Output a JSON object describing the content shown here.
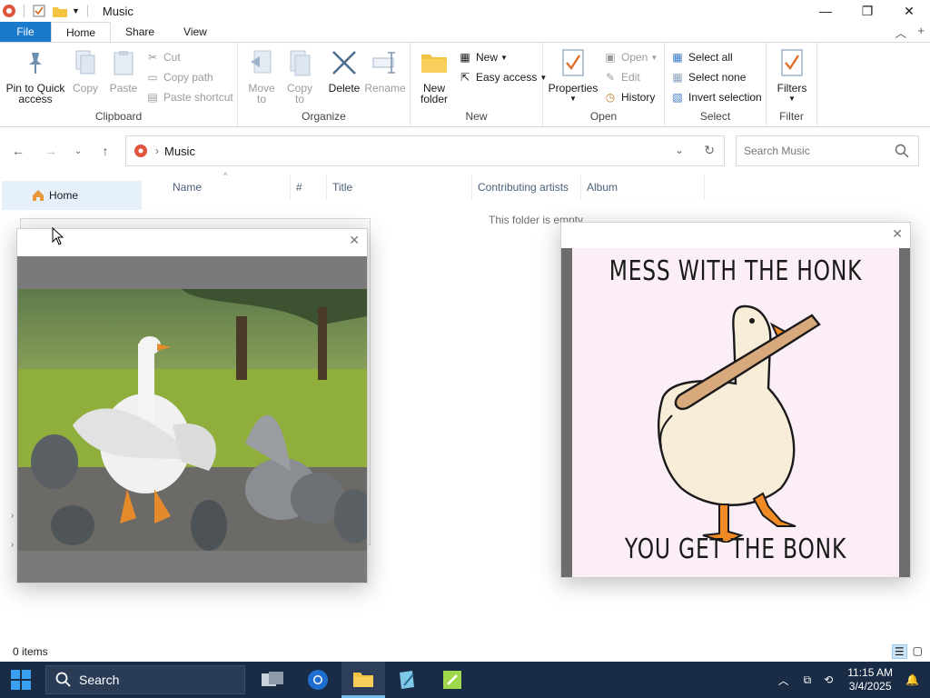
{
  "window": {
    "title": "Music"
  },
  "ribbon": {
    "tabs": [
      "File",
      "Home",
      "Share",
      "View"
    ],
    "clipboard": {
      "label": "Clipboard",
      "pin_line1": "Pin to Quick",
      "pin_line2": "access",
      "copy": "Copy",
      "paste": "Paste",
      "cut": "Cut",
      "copy_path": "Copy path",
      "paste_shortcut": "Paste shortcut"
    },
    "organize": {
      "label": "Organize",
      "move_line1": "Move",
      "move_line2": "to",
      "copy_line1": "Copy",
      "copy_line2": "to",
      "delete": "Delete",
      "rename": "Rename"
    },
    "new": {
      "label": "New",
      "new_folder_line1": "New",
      "new_folder_line2": "folder",
      "new_item": "New",
      "easy_access": "Easy access"
    },
    "open": {
      "label": "Open",
      "properties": "Properties",
      "open": "Open",
      "edit": "Edit",
      "history": "History"
    },
    "select": {
      "label": "Select",
      "select_all": "Select all",
      "select_none": "Select none",
      "invert": "Invert selection"
    },
    "filter": {
      "label": "Filter",
      "filters": "Filters"
    }
  },
  "address": {
    "path": "Music",
    "search_placeholder": "Search Music"
  },
  "nav": {
    "home": "Home"
  },
  "columns": [
    "Name",
    "#",
    "Title",
    "Contributing artists",
    "Album"
  ],
  "content": {
    "empty_message": "This folder is empty."
  },
  "poster": {
    "top_text": "MESS WITH THE HONK",
    "bottom_text": "YOU GET THE BONK"
  },
  "status": {
    "items": "0 items"
  },
  "taskbar": {
    "search": "Search",
    "time": "11:15 AM",
    "date": "3/4/2025"
  },
  "colors": {
    "accent": "#1979ca",
    "taskbar": "#1a2b45",
    "poster_bg": "#fbeef6",
    "beak": "#f08a24"
  }
}
